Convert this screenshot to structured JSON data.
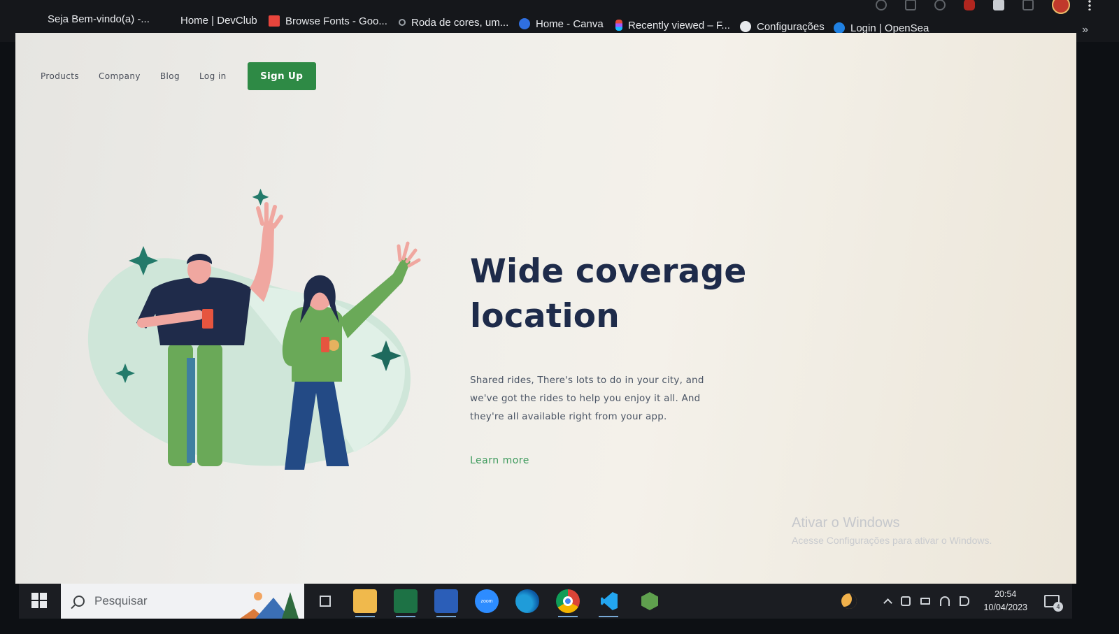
{
  "bookmarks": [
    {
      "label": "Seja Bem-vindo(a) -...",
      "icon": "devclub-icon",
      "color": "#1e1f24"
    },
    {
      "label": "Home | DevClub",
      "icon": "devclub-icon",
      "color": "#1e1f24"
    },
    {
      "label": "Browse Fonts - Goo...",
      "icon": "google-fonts-icon",
      "color": "#e8453c"
    },
    {
      "label": "Roda de cores, um...",
      "icon": "color-wheel-icon",
      "color": "#9aa0a6"
    },
    {
      "label": "Home - Canva",
      "icon": "canva-icon",
      "color": "#2f6fe0"
    },
    {
      "label": "Recently viewed – F...",
      "icon": "figma-icon",
      "color": "#e24a3b"
    },
    {
      "label": "Configurações",
      "icon": "gear-icon",
      "color": "#e8eaed"
    },
    {
      "label": "Login | OpenSea",
      "icon": "opensea-icon",
      "color": "#2081e2"
    }
  ],
  "more_bookmarks": "»",
  "nav": {
    "links": [
      "Products",
      "Company",
      "Blog",
      "Log in"
    ],
    "signup": "Sign Up"
  },
  "hero": {
    "title_line1": "Wide coverage",
    "title_line2": "location",
    "text": "Shared rides, There's lots to do in your city, and we've got the rides to help you enjoy it all. And they're all available right from your app.",
    "link": "Learn more"
  },
  "watermark": {
    "title": "Ativar o Windows",
    "subtitle": "Acesse Configurações para ativar o Windows."
  },
  "taskbar": {
    "search_placeholder": "Pesquisar",
    "apps": [
      "task-view-icon",
      "file-explorer-icon",
      "excel-icon",
      "word-icon",
      "zoom-icon",
      "edge-icon",
      "chrome-icon",
      "vscode-icon",
      "nodejs-icon"
    ],
    "zoom_label": "zoom",
    "time": "20:54",
    "date": "10/04/2023",
    "notifications": "4"
  },
  "colors": {
    "accent": "#2e8a45",
    "title": "#1e2b4a",
    "link": "#3d9a5c"
  }
}
